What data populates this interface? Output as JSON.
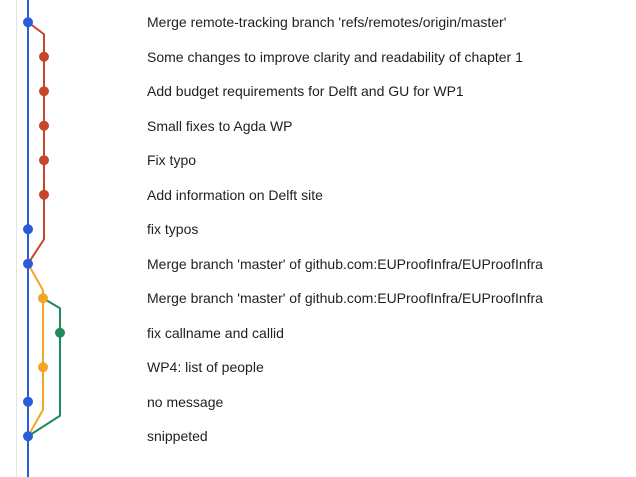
{
  "commit_graph": {
    "branch_colors": {
      "main": "#2b5bd7",
      "feature": "#c6462b",
      "merge": "#f2a623",
      "green": "#1f8a5b"
    },
    "commits": [
      {
        "message": "Merge remote-tracking branch 'refs/remotes/origin/master'",
        "lane": "main"
      },
      {
        "message": "Some changes to improve clarity and readability of chapter 1",
        "lane": "feature"
      },
      {
        "message": "Add budget requirements for Delft and GU for WP1",
        "lane": "feature"
      },
      {
        "message": "Small fixes to Agda WP",
        "lane": "feature"
      },
      {
        "message": "Fix typo",
        "lane": "feature"
      },
      {
        "message": "Add information on Delft site",
        "lane": "feature"
      },
      {
        "message": "fix typos",
        "lane": "main"
      },
      {
        "message": "Merge branch 'master' of github.com:EUProofInfra/EUProofInfra",
        "lane": "main"
      },
      {
        "message": "Merge branch 'master' of github.com:EUProofInfra/EUProofInfra",
        "lane": "merge"
      },
      {
        "message": "fix callname and callid",
        "lane": "green"
      },
      {
        "message": "WP4: list of people",
        "lane": "merge"
      },
      {
        "message": "no message",
        "lane": "main"
      },
      {
        "message": "snippeted",
        "lane": "main"
      },
      {
        "message": "",
        "lane": "main"
      }
    ]
  }
}
